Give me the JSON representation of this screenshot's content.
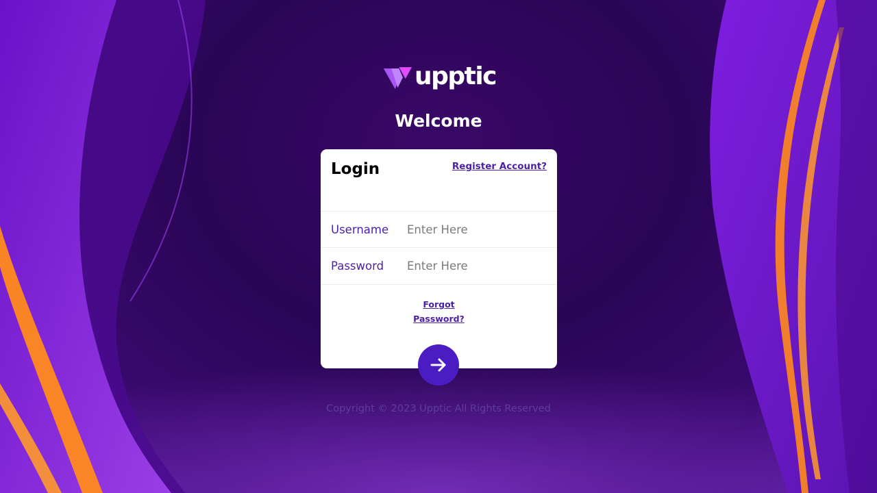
{
  "brand": {
    "name": "upptic",
    "logo_icon": "upptic-v-logo",
    "accent_color": "#4a1cc2",
    "logo_pink": "#e04dff",
    "logo_purple": "#a855f7"
  },
  "welcome": "Welcome",
  "login_card": {
    "title": "Login",
    "register_link": "Register Account?",
    "username": {
      "label": "Username",
      "placeholder": "Enter Here",
      "value": ""
    },
    "password": {
      "label": "Password",
      "placeholder": "Enter Here",
      "value": ""
    },
    "forgot_line1": "Forgot",
    "forgot_line2": "Password?",
    "submit_icon": "arrow-right-icon"
  },
  "footer": {
    "copyright": "Copyright © 2023 Upptic All Rights Reserved"
  }
}
